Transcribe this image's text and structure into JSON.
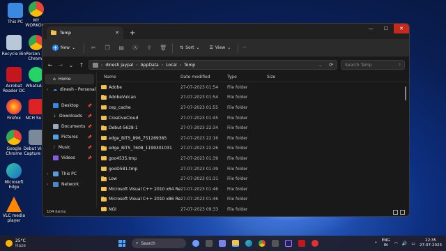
{
  "desktop": {
    "icons": [
      {
        "label": "This PC"
      },
      {
        "label": "MY WORKOUT"
      },
      {
        "label": "Recycle Bin"
      },
      {
        "label": "Person 1 - Chrome"
      },
      {
        "label": "Acrobat Reader DC"
      },
      {
        "label": "WhatsApp"
      },
      {
        "label": "Firefox"
      },
      {
        "label": "NCH Suite"
      },
      {
        "label": "Google Chrome"
      },
      {
        "label": "Debut Video Capture S..."
      },
      {
        "label": "Microsoft Edge"
      },
      {
        "label": "VLC media player"
      }
    ]
  },
  "window": {
    "tab_title": "Temp",
    "toolbar": {
      "new_label": "New",
      "sort_label": "Sort",
      "view_label": "View",
      "more_label": "···"
    },
    "breadcrumb": [
      "dinesh jaypal",
      "AppData",
      "Local",
      "Temp"
    ],
    "search_placeholder": "Search Temp",
    "nav": {
      "home": "Home",
      "personal": "dinesh - Personal",
      "quick": [
        {
          "label": "Desktop"
        },
        {
          "label": "Downloads"
        },
        {
          "label": "Documents"
        },
        {
          "label": "Pictures"
        },
        {
          "label": "Music"
        },
        {
          "label": "Videos"
        }
      ],
      "this_pc": "This PC",
      "network": "Network"
    },
    "columns": {
      "name": "Name",
      "date": "Date modified",
      "type": "Type",
      "size": "Size"
    },
    "files": [
      {
        "name": "Adobe",
        "date": "27-07-2023 01:54",
        "type": "File folder"
      },
      {
        "name": "AdobeVulcan",
        "date": "27-07-2023 01:54",
        "type": "File folder"
      },
      {
        "name": "cep_cache",
        "date": "27-07-2023 01:55",
        "type": "File folder"
      },
      {
        "name": "CreativeCloud",
        "date": "27-07-2023 01:45",
        "type": "File folder"
      },
      {
        "name": "Debut-5628-1",
        "date": "27-07-2023 22:34",
        "type": "File folder"
      },
      {
        "name": "edge_BITS_896_751269385",
        "date": "27-07-2023 22:16",
        "type": "File folder"
      },
      {
        "name": "edge_BITS_7608_1199301031",
        "date": "27-07-2023 22:26",
        "type": "File folder"
      },
      {
        "name": "goo4535.tmp",
        "date": "27-07-2023 01:39",
        "type": "File folder"
      },
      {
        "name": "gooD581.tmp",
        "date": "27-07-2023 01:39",
        "type": "File folder"
      },
      {
        "name": "Low",
        "date": "27-07-2023 01:31",
        "type": "File folder"
      },
      {
        "name": "Microsoft Visual C++ 2010  x64 Redistrib...",
        "date": "27-07-2023 01:46",
        "type": "File folder"
      },
      {
        "name": "Microsoft Visual C++ 2010  x86 Redistrib...",
        "date": "27-07-2023 01:46",
        "type": "File folder"
      },
      {
        "name": "NGI",
        "date": "27-07-2023 09:33",
        "type": "File folder"
      }
    ],
    "status": "104 items"
  },
  "taskbar": {
    "weather_temp": "25°C",
    "weather_desc": "Haze",
    "search_label": "Search",
    "lang_line1": "ENG",
    "lang_line2": "IN",
    "time": "22:35",
    "date": "27-07-2023"
  },
  "colors": {
    "accent": "#2d8cff",
    "folder": "#f2c14e",
    "close_red": "#c42b1c"
  }
}
